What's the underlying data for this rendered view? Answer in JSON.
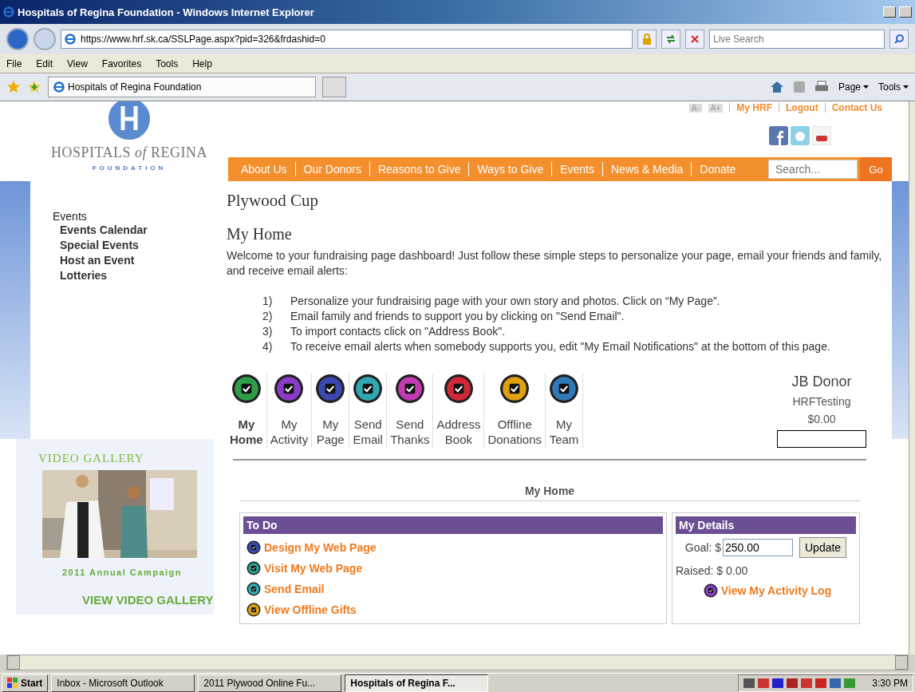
{
  "browser": {
    "title": "Hospitals of Regina Foundation - Windows Internet Explorer",
    "address": "https://www.hrf.sk.ca/SSLPage.aspx?pid=326&frdashid=0",
    "search_placeholder": "Live Search",
    "menu": [
      "File",
      "Edit",
      "View",
      "Favorites",
      "Tools",
      "Help"
    ],
    "tab_title": "Hospitals of Regina Foundation",
    "toolbar": [
      "Page",
      "Tools"
    ]
  },
  "site": {
    "logo_name": "HOSPITALS *of* REGINA",
    "logo_sub": "FOUNDATION",
    "font_buttons": [
      "A-",
      "A+"
    ],
    "top_links": [
      "My HRF",
      "Logout",
      "Contact Us"
    ],
    "nav": [
      "About Us",
      "Our Donors",
      "Reasons to Give",
      "Ways to Give",
      "Events",
      "News & Media",
      "Donate"
    ],
    "search_placeholder": "Search...",
    "go": "Go"
  },
  "sidebar": {
    "section": "Events",
    "items": [
      "Events Calendar",
      "Special Events",
      "Host an Event",
      "Lotteries"
    ],
    "video_gallery": {
      "title": "VIDEO GALLERY",
      "caption": "2011 Annual Campaign",
      "link": "VIEW VIDEO GALLERY"
    }
  },
  "main": {
    "page_title": "Plywood Cup",
    "heading": "My Home",
    "intro": "Welcome to your fundraising page dashboard! Just follow these simple steps to personalize your page, email your friends and family, and receive email alerts:",
    "steps": [
      {
        "number": "1)",
        "text": "Personalize your fundraising page with your own story and photos. Click on “My Page”."
      },
      {
        "number": "2)",
        "text": "Email family and friends to support you by clicking on \"Send Email\"."
      },
      {
        "number": "3)",
        "text": "To import contacts click on \"Address Book\"."
      },
      {
        "number": "4)",
        "text": "To receive email alerts when somebody supports you, edit \"My Email Notifications\" at the bottom of this page."
      }
    ],
    "dashboard": [
      {
        "line1": "My",
        "line2": "Home",
        "selected": true,
        "color": "#2e9e4a"
      },
      {
        "line1": "My",
        "line2": "Activity",
        "selected": false,
        "color": "#8a3cc8"
      },
      {
        "line1": "My",
        "line2": "Page",
        "selected": false,
        "color": "#3a48b0"
      },
      {
        "line1": "Send",
        "line2": "Email",
        "selected": false,
        "color": "#30a8b0"
      },
      {
        "line1": "Send",
        "line2": "Thanks",
        "selected": false,
        "color": "#c03cb0"
      },
      {
        "line1": "Address",
        "line2": "Book",
        "selected": false,
        "color": "#d02838"
      },
      {
        "line1": "Offline",
        "line2": "Donations",
        "selected": false,
        "color": "#e0a010"
      },
      {
        "line1": "My",
        "line2": "Team",
        "selected": false,
        "color": "#3078b8"
      }
    ],
    "profile": {
      "name": "JB Donor",
      "team": "HRFTesting",
      "amount": "$0.00",
      "level": 0
    },
    "section_heading": "My Home",
    "todo": {
      "title": "To Do",
      "items": [
        {
          "label": "Design My Web Page",
          "color": "#3a48b0"
        },
        {
          "label": "Visit My Web Page",
          "color": "#2a9a8a"
        },
        {
          "label": "Send Email",
          "color": "#30a8b0"
        },
        {
          "label": "View Offline Gifts",
          "color": "#e0a010"
        }
      ]
    },
    "details": {
      "title": "My Details",
      "goal_label": "Goal: $",
      "goal_value": "250.00",
      "update": "Update",
      "raised": "Raised: $ 0.00",
      "activity_link": "View My Activity Log"
    }
  },
  "taskbar": {
    "start": "Start",
    "tasks": [
      {
        "label": "Inbox - Microsoft Outlook",
        "selected": false
      },
      {
        "label": "2011 Plywood Online Fu...",
        "selected": false
      },
      {
        "label": "Hospitals of Regina F...",
        "selected": true
      }
    ],
    "clock": "3:30 PM"
  }
}
